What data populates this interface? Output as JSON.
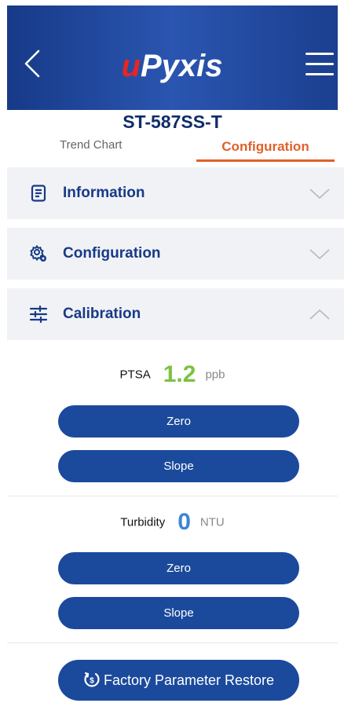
{
  "header": {
    "logo_mark": "u",
    "logo_text": "Pyxis",
    "back_icon": "chevron-left-icon",
    "menu_icon": "hamburger-menu-icon"
  },
  "device": {
    "title": "ST-587SS-T"
  },
  "tabs": [
    {
      "label": "Trend Chart",
      "active": false
    },
    {
      "label": "Configuration",
      "active": true
    }
  ],
  "sections": [
    {
      "label": "Information",
      "icon": "document-list-icon",
      "expanded": false
    },
    {
      "label": "Configuration",
      "icon": "gear-settings-icon",
      "expanded": false
    },
    {
      "label": "Calibration",
      "icon": "sliders-icon",
      "expanded": true
    }
  ],
  "calibration": {
    "ptsa": {
      "name": "PTSA",
      "value": "1.2",
      "unit": "ppb",
      "value_color": "#7cc142",
      "zero_label": "Zero",
      "slope_label": "Slope"
    },
    "turbidity": {
      "name": "Turbidity",
      "value": "0",
      "unit": "NTU",
      "value_color": "#3a86d6",
      "zero_label": "Zero",
      "slope_label": "Slope"
    }
  },
  "restore": {
    "label": "Factory Parameter Restore",
    "icon": "restore-icon"
  },
  "colors": {
    "brand_blue": "#173a88",
    "button_blue": "#1b4a9c",
    "accent_orange": "#e0602a",
    "logo_red": "#e8261f"
  }
}
